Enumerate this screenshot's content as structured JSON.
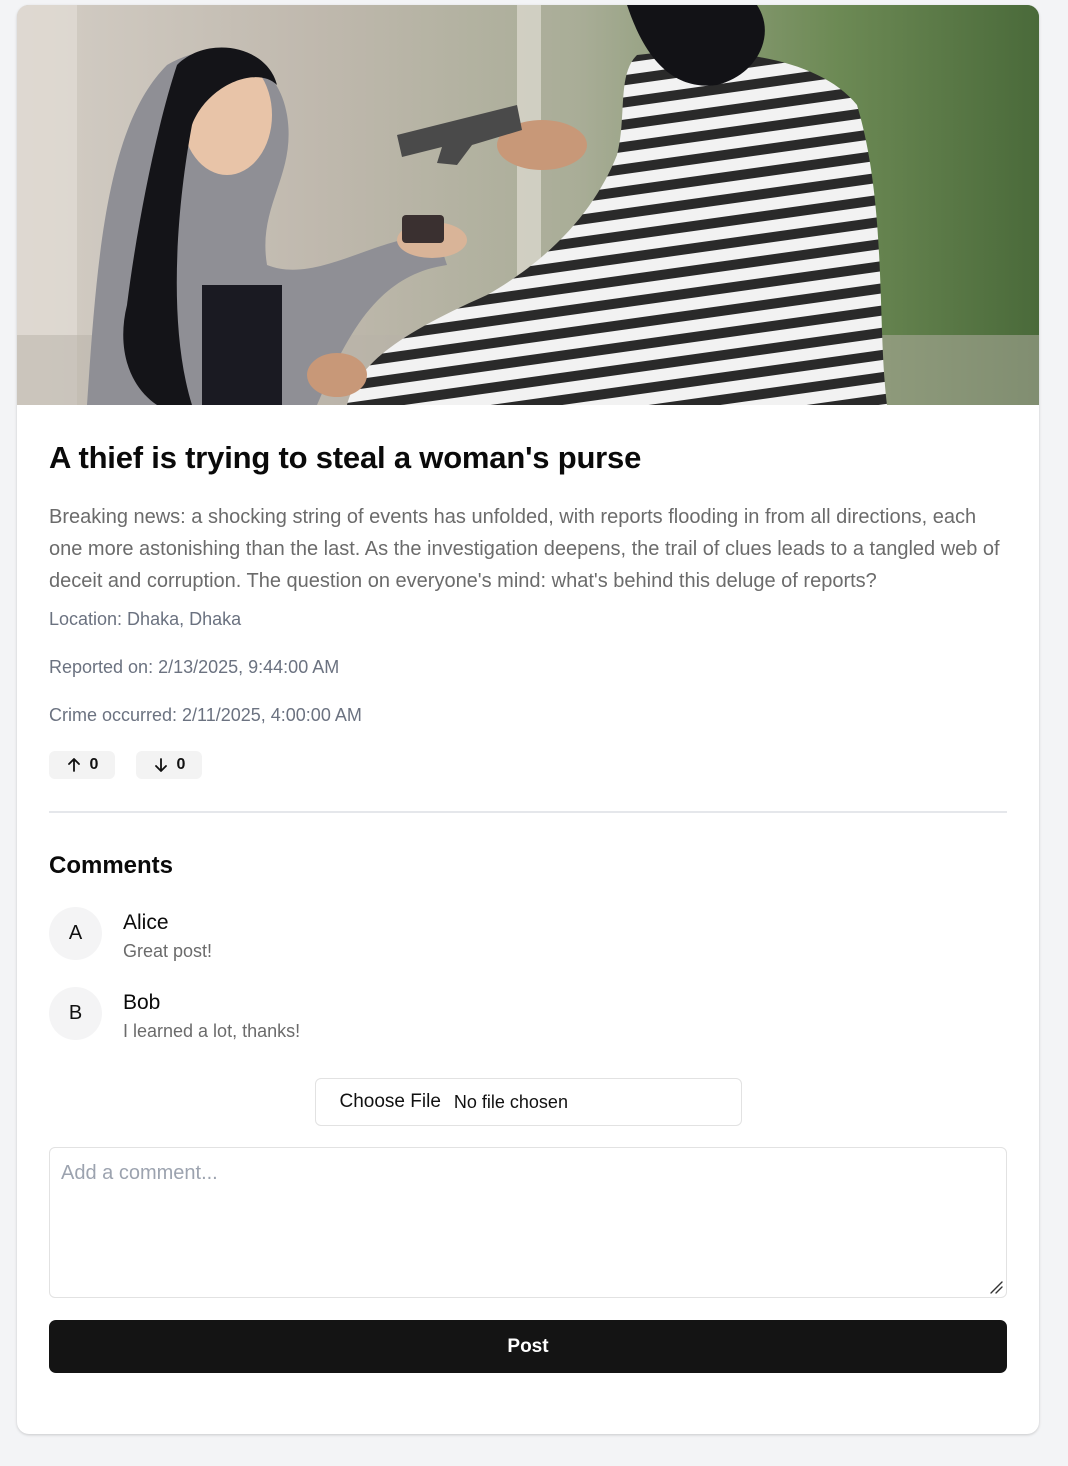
{
  "post": {
    "title": "A thief is trying to steal a woman's purse",
    "description": "Breaking news: a shocking string of events has unfolded, with reports flooding in from all directions, each one more astonishing than the last. As the investigation deepens, the trail of clues leads to a tangled web of deceit and corruption. The question on everyone's mind: what's behind this deluge of reports?",
    "location": "Location: Dhaka, Dhaka",
    "reported_on": "Reported on: 2/13/2025, 9:44:00 AM",
    "crime_occurred": "Crime occurred: 2/11/2025, 4:00:00 AM",
    "upvotes": "0",
    "downvotes": "0",
    "upvote_icon": "arrow-up-icon",
    "downvote_icon": "arrow-down-icon"
  },
  "comments": {
    "heading": "Comments",
    "items": [
      {
        "initial": "A",
        "author": "Alice",
        "text": "Great post!"
      },
      {
        "initial": "B",
        "author": "Bob",
        "text": "I learned a lot, thanks!"
      }
    ]
  },
  "composer": {
    "file_button_label": "Choose File",
    "file_status": "No file chosen",
    "comment_value": "",
    "comment_placeholder": "Add a comment...",
    "post_label": "Post"
  },
  "colors": {
    "page_background": "#f3f4f6",
    "post_button": "#141414",
    "muted_text": "#6b6b6b"
  }
}
